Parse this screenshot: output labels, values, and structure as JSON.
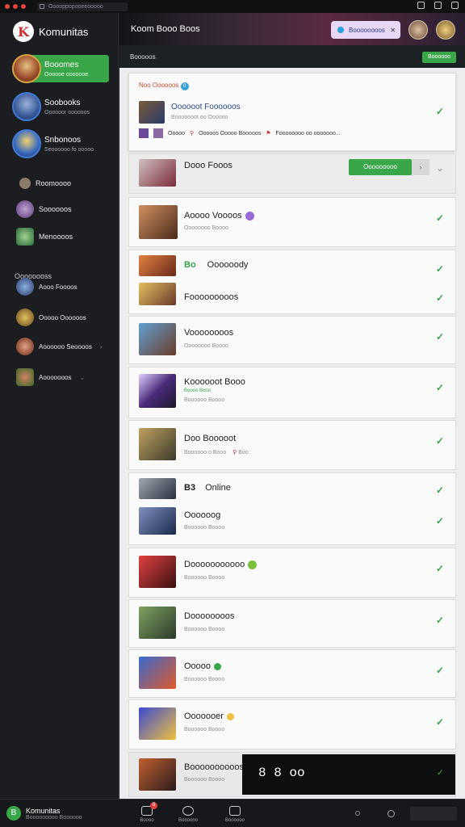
{
  "window": {
    "url": "Ooooppopooeeooooo"
  },
  "app": {
    "name": "Komunitas"
  },
  "sidebar": {
    "big_items": [
      {
        "title": "Booomes",
        "sub": "Oooooe ooooooe"
      },
      {
        "title": "Soobooks",
        "sub": "Oooooor oooooos"
      },
      {
        "title": "Snbonoos",
        "sub": "Seoooooo fo ooooo"
      }
    ],
    "small_items": [
      {
        "label": "Roomoooo"
      },
      {
        "label": "Soooooos"
      },
      {
        "label": "Menoooos"
      }
    ],
    "section_label": "Oooooooss",
    "section_items": [
      {
        "label": "Aooo Foooos"
      },
      {
        "label": "Ooooo Oooooos"
      },
      {
        "label": "Aoooooo Seoooos"
      },
      {
        "label": "Aooooooos"
      }
    ]
  },
  "banner": {
    "title": "Koom Booo Boos",
    "pill_label": "Boooooooos"
  },
  "subhead": {
    "label": "Booooos",
    "button": "Boooooo"
  },
  "featured": {
    "tag": "Noo Oooooos",
    "tag_count": "0",
    "title": "Oooooot Foooooos",
    "sub": "Booooooot oo Oooooo",
    "meta1": "Ooooo",
    "meta2": "Ooooos Ooooo Booooos",
    "meta3": "Foooooooo oo ooooooo..."
  },
  "rows": [
    {
      "title": "Dooo Fooos",
      "sub": "",
      "button": "Ooooooooo"
    },
    {
      "title": "Aoooo Voooos",
      "sub": "Oooooooo Boooo"
    },
    {
      "title": "Oooooody",
      "prefix": "Bo",
      "sub": ""
    },
    {
      "title": "Fooooooooos",
      "sub": ""
    },
    {
      "title": "Voooooooos",
      "sub": "Oooooooo Boooo"
    },
    {
      "title": "Koooooot Booo",
      "sub": "Boooooo Boooo",
      "tag": "Boooo Booo"
    },
    {
      "title": "Doo Booooot",
      "sub": "Boooooo o Booo",
      "meta": "Boo"
    },
    {
      "title": "Online",
      "prefix": "B3",
      "sub": ""
    },
    {
      "title": "Oooooog",
      "sub": "Boooooo Boooo"
    },
    {
      "title": "Dooooooooooo",
      "sub": "Boooooo Boooo"
    },
    {
      "title": "Doooooooos",
      "sub": "Boooooo Boooo"
    },
    {
      "title": "Ooooo",
      "sub": "Boooooo Boooo"
    },
    {
      "title": "Ooooooer",
      "sub": "Boooooo Boooo"
    },
    {
      "title": "Boooooooooos",
      "sub": "Boooooo Boooo",
      "overlay": "8 8 oo"
    }
  ],
  "bottombar": {
    "user_name": "Komunitas",
    "user_sub": "Booooooooo Boooooo",
    "tabs": [
      "Boooo",
      "Boooooo",
      "Boooooo"
    ],
    "notification": "8"
  }
}
